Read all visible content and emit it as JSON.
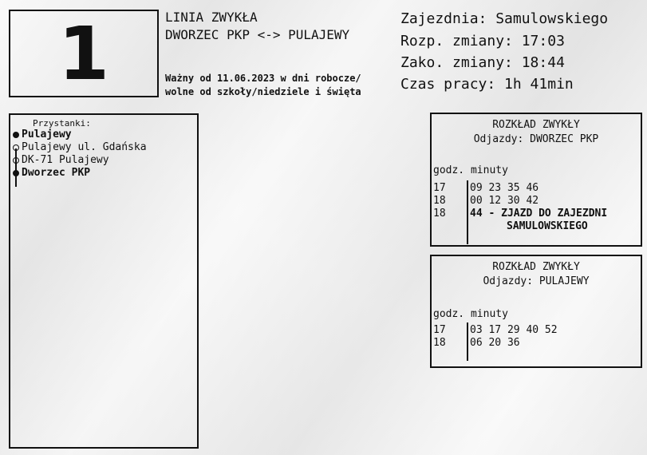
{
  "header": {
    "line_number": "1",
    "line_kind": "LINIA ZWYKŁA",
    "route": "DWORZEC PKP <-> PULAJEWY",
    "valid_line1": "Ważny od 11.06.2023 w dni robocze/",
    "valid_line2": "wolne od szkoły/niedziele i święta"
  },
  "info": {
    "depot": "Zajezdnia: Samulowskiego",
    "shift_start": "Rozp. zmiany: 17:03",
    "shift_end": "Zako. zmiany: 18:44",
    "work_time": "Czas pracy: 1h 41min"
  },
  "stops": {
    "title": "Przystanki:",
    "items": [
      {
        "label": "Pulajewy",
        "terminal": true
      },
      {
        "label": "Pulajewy ul. Gdańska",
        "terminal": false
      },
      {
        "label": "DK-71 Pulajewy",
        "terminal": false
      },
      {
        "label": "Dworzec PKP",
        "terminal": true
      }
    ]
  },
  "timetables": [
    {
      "title": "ROZKŁAD ZWYKŁY",
      "subtitle": "Odjazdy: DWORZEC PKP",
      "header": "godz. minuty",
      "rows": [
        {
          "hour": "17",
          "minutes": "09 23 35 46"
        },
        {
          "hour": "18",
          "minutes": "00 12 30 42"
        },
        {
          "hour": "18",
          "minutes": "44 - ZJAZD DO ZAJEZDNI"
        },
        {
          "hour": "",
          "minutes": "SAMULOWSKIEGO"
        }
      ]
    },
    {
      "title": "ROZKŁAD ZWYKŁY",
      "subtitle": "Odjazdy: PULAJEWY",
      "header": "godz. minuty",
      "rows": [
        {
          "hour": "17",
          "minutes": "03 17 29 40 52"
        },
        {
          "hour": "18",
          "minutes": "06 20 36"
        }
      ]
    }
  ]
}
